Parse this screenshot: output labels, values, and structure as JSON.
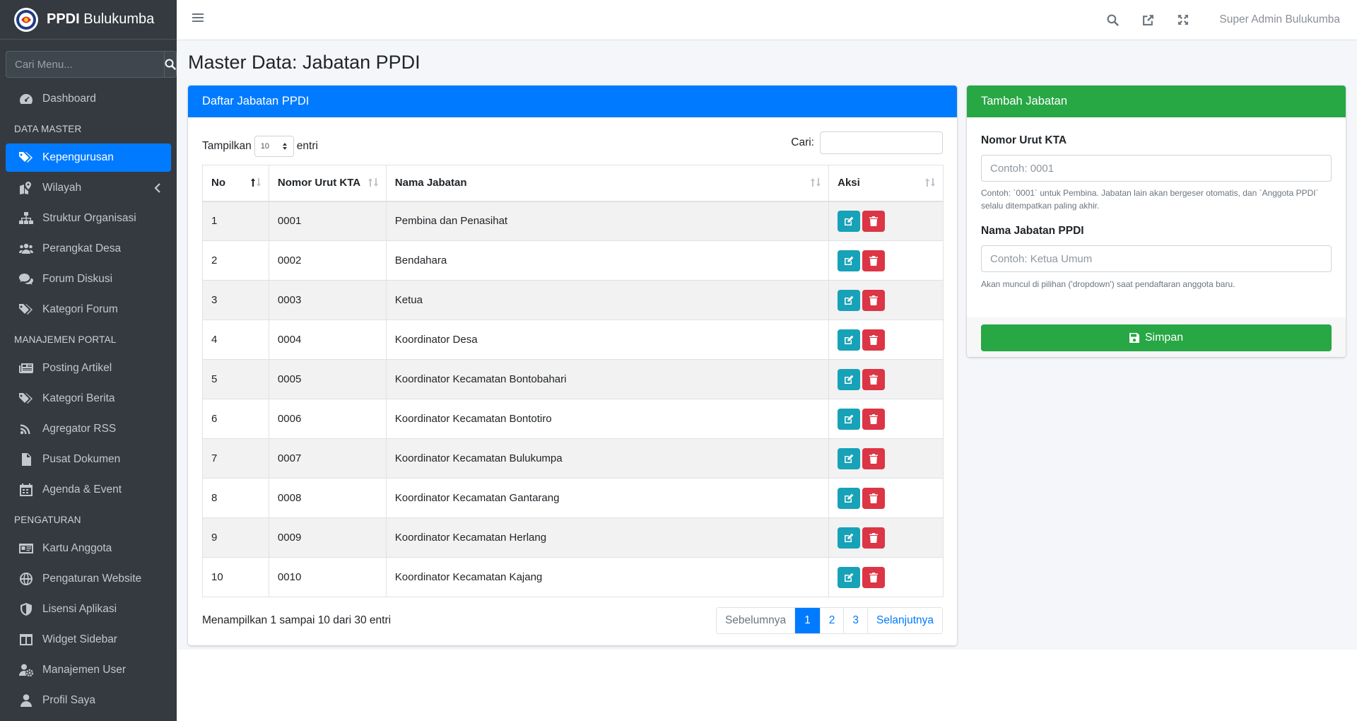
{
  "brand": {
    "bold": "PPDI",
    "rest": " Bulukumba"
  },
  "sidebar": {
    "search_placeholder": "Cari Menu...",
    "items": [
      {
        "label": "Dashboard",
        "icon": "dashboard-icon"
      },
      {
        "header": "DATA MASTER"
      },
      {
        "label": "Kepengurusan",
        "icon": "tags-icon",
        "active": true
      },
      {
        "label": "Wilayah",
        "icon": "map-icon"
      },
      {
        "label": "Struktur Organisasi",
        "icon": "sitemap-icon"
      },
      {
        "label": "Perangkat Desa",
        "icon": "users-icon"
      },
      {
        "label": "Forum Diskusi",
        "icon": "comments-icon"
      },
      {
        "label": "Kategori Forum",
        "icon": "tags-icon"
      },
      {
        "header": "MANAJEMEN PORTAL"
      },
      {
        "label": "Posting Artikel",
        "icon": "newspaper-icon"
      },
      {
        "label": "Kategori Berita",
        "icon": "tags-icon"
      },
      {
        "label": "Agregator RSS",
        "icon": "rss-icon"
      },
      {
        "label": "Pusat Dokumen",
        "icon": "file-pdf-icon"
      },
      {
        "label": "Agenda & Event",
        "icon": "calendar-icon"
      },
      {
        "header": "PENGATURAN"
      },
      {
        "label": "Kartu Anggota",
        "icon": "id-card-icon"
      },
      {
        "label": "Pengaturan Website",
        "icon": "globe-icon"
      },
      {
        "label": "Lisensi Aplikasi",
        "icon": "shield-icon"
      },
      {
        "label": "Widget Sidebar",
        "icon": "columns-icon"
      },
      {
        "label": "Manajemen User",
        "icon": "user-cog-icon"
      },
      {
        "label": "Profil Saya",
        "icon": "user-icon"
      }
    ]
  },
  "topbar": {
    "user": "Super Admin Bulukumba"
  },
  "page": {
    "title": "Master Data: Jabatan PPDI"
  },
  "list": {
    "title": "Daftar Jabatan PPDI",
    "show_label": "Tampilkan",
    "length_value": "10",
    "entries_label": "entri",
    "search_label": "Cari:",
    "columns": [
      "No",
      "Nomor Urut KTA",
      "Nama Jabatan",
      "Aksi"
    ],
    "rows": [
      {
        "no": "1",
        "kta": "0001",
        "nama": "Pembina dan Penasihat"
      },
      {
        "no": "2",
        "kta": "0002",
        "nama": "Bendahara"
      },
      {
        "no": "3",
        "kta": "0003",
        "nama": "Ketua"
      },
      {
        "no": "4",
        "kta": "0004",
        "nama": "Koordinator Desa"
      },
      {
        "no": "5",
        "kta": "0005",
        "nama": "Koordinator Kecamatan Bontobahari"
      },
      {
        "no": "6",
        "kta": "0006",
        "nama": "Koordinator Kecamatan Bontotiro"
      },
      {
        "no": "7",
        "kta": "0007",
        "nama": "Koordinator Kecamatan Bulukumpa"
      },
      {
        "no": "8",
        "kta": "0008",
        "nama": "Koordinator Kecamatan Gantarang"
      },
      {
        "no": "9",
        "kta": "0009",
        "nama": "Koordinator Kecamatan Herlang"
      },
      {
        "no": "10",
        "kta": "0010",
        "nama": "Koordinator Kecamatan Kajang"
      }
    ],
    "info": "Menampilkan 1 sampai 10 dari 30 entri",
    "pagination": {
      "prev": "Sebelumnya",
      "pages": [
        "1",
        "2",
        "3"
      ],
      "next": "Selanjutnya",
      "active": "1"
    }
  },
  "form": {
    "title": "Tambah Jabatan",
    "kta_label": "Nomor Urut KTA",
    "kta_placeholder": "Contoh: 0001",
    "kta_help": "Contoh: `0001` untuk Pembina. Jabatan lain akan bergeser otomatis, dan `Anggota PPDI` selalu ditempatkan paling akhir.",
    "nama_label": "Nama Jabatan PPDI",
    "nama_placeholder": "Contoh: Ketua Umum",
    "nama_help": "Akan muncul di pilihan ('dropdown') saat pendaftaran anggota baru.",
    "save_label": "Simpan"
  },
  "colors": {
    "primary": "#007bff",
    "success": "#28a745",
    "info": "#17a2b8",
    "danger": "#dc3545",
    "sidebar": "#343a40",
    "content_bg": "#f4f6f9"
  }
}
